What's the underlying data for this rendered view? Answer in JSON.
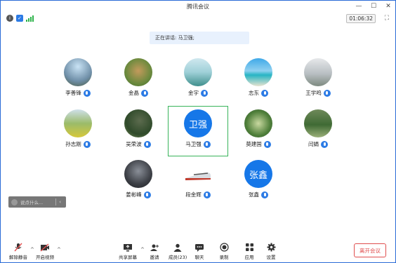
{
  "window": {
    "title": "腾讯会议",
    "timer": "01:06:32"
  },
  "speaking": {
    "text": "正在讲话: 马卫强;"
  },
  "participants": [
    {
      "name": "李善锋",
      "avatar": "photo"
    },
    {
      "name": "金晶",
      "avatar": "photo"
    },
    {
      "name": "金宇",
      "avatar": "photo"
    },
    {
      "name": "志东",
      "avatar": "photo"
    },
    {
      "name": "王学鸣",
      "avatar": "photo"
    },
    {
      "name": "孙志刚",
      "avatar": "photo"
    },
    {
      "name": "吴荣波",
      "avatar": "photo"
    },
    {
      "name": "马卫强",
      "avatar_text": "卫强"
    },
    {
      "name": "莫建国",
      "avatar": "photo"
    },
    {
      "name": "闫娟",
      "avatar": "photo"
    },
    {
      "name": "姜彬峰",
      "avatar": "photo"
    },
    {
      "name": "段金辉",
      "avatar": "photo"
    },
    {
      "name": "张鑫",
      "avatar_text": "张鑫"
    }
  ],
  "chat": {
    "placeholder": "说点什么..."
  },
  "toolbar": {
    "unmute": "解除静音",
    "start_video": "开启视频",
    "share_screen": "共享屏幕",
    "invite": "邀请",
    "members": "成员(23)",
    "chat": "聊天",
    "record": "录制",
    "apps": "应用",
    "settings": "设置",
    "leave": "离开会议"
  },
  "colors": {
    "accent": "#2c7be5",
    "danger": "#e04e4e",
    "active_speaker": "#38b35a"
  }
}
